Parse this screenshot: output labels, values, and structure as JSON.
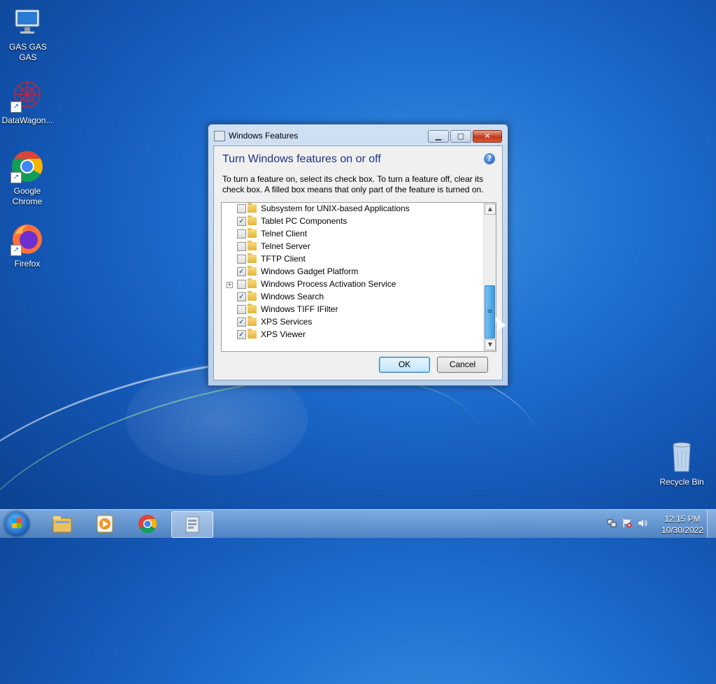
{
  "desktop": {
    "icons": [
      {
        "label": "GAS GAS GAS",
        "icon": "computer-icon"
      },
      {
        "label": "DataWagon...",
        "icon": "datawagon-icon"
      },
      {
        "label": "Google Chrome",
        "icon": "chrome-icon"
      },
      {
        "label": "Firefox",
        "icon": "firefox-icon"
      },
      {
        "label": "Recycle Bin",
        "icon": "recycle-bin-icon"
      }
    ]
  },
  "dialog": {
    "title": "Windows Features",
    "heading": "Turn Windows features on or off",
    "description": "To turn a feature on, select its check box. To turn a feature off, clear its check box. A filled box means that only part of the feature is turned on.",
    "help_symbol": "?",
    "features": [
      {
        "label": "Subsystem for UNIX-based Applications",
        "checked": false,
        "expandable": false
      },
      {
        "label": "Tablet PC Components",
        "checked": true,
        "expandable": false
      },
      {
        "label": "Telnet Client",
        "checked": false,
        "expandable": false
      },
      {
        "label": "Telnet Server",
        "checked": false,
        "expandable": false
      },
      {
        "label": "TFTP Client",
        "checked": false,
        "expandable": false
      },
      {
        "label": "Windows Gadget Platform",
        "checked": true,
        "expandable": false
      },
      {
        "label": "Windows Process Activation Service",
        "checked": false,
        "expandable": true
      },
      {
        "label": "Windows Search",
        "checked": true,
        "expandable": false
      },
      {
        "label": "Windows TIFF IFilter",
        "checked": false,
        "expandable": false
      },
      {
        "label": "XPS Services",
        "checked": true,
        "expandable": false
      },
      {
        "label": "XPS Viewer",
        "checked": true,
        "expandable": false
      }
    ],
    "ok_label": "OK",
    "cancel_label": "Cancel",
    "check_mark": "✓",
    "expand_mark": "+"
  },
  "taskbar": {
    "pinned": [
      {
        "icon": "file-explorer-icon",
        "active": false
      },
      {
        "icon": "media-player-icon",
        "active": false
      },
      {
        "icon": "chrome-icon",
        "active": false
      },
      {
        "icon": "windows-features-icon",
        "active": true
      }
    ],
    "clock": {
      "time": "12:15 PM",
      "date": "10/30/2022"
    }
  },
  "colors": {
    "heading": "#1e3287",
    "accent": "#3b9ade"
  }
}
